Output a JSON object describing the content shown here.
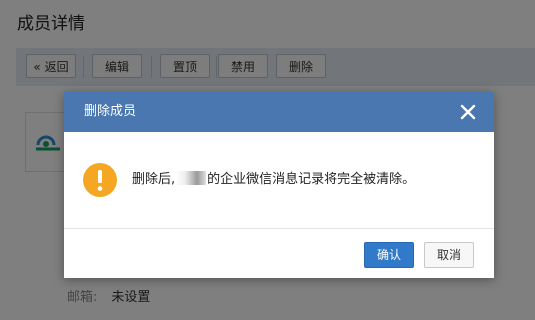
{
  "page": {
    "title": "成员详情"
  },
  "toolbar": {
    "back_icon": "«",
    "back_label": "返回",
    "edit_label": "编辑",
    "pin_label": "置顶",
    "disable_label": "禁用",
    "delete_label": "删除"
  },
  "details": {
    "email_label": "邮箱:",
    "email_value": "未设置"
  },
  "dialog": {
    "title": "删除成员",
    "close_icon": "close-icon",
    "warning_icon": "warning-icon",
    "message_prefix": "删除后,",
    "message_suffix": "的企业微信消息记录将完全被清除。",
    "confirm_label": "确认",
    "cancel_label": "取消"
  },
  "colors": {
    "header": "#4a77b0",
    "primary_button": "#3179c9",
    "warning": "#f5a623",
    "toolbar_bg": "#e5ebf2"
  }
}
